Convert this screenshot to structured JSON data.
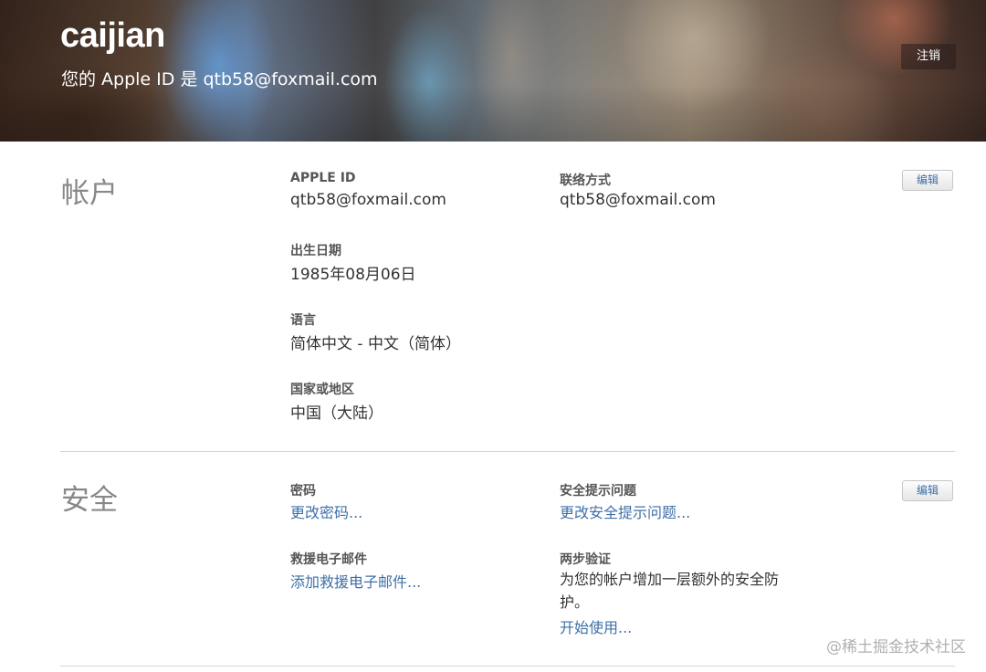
{
  "header": {
    "username": "caijian",
    "subtitle": "您的 Apple ID 是 qtb58@foxmail.com",
    "signout_label": "注销"
  },
  "account": {
    "title": "帐户",
    "edit_label": "编辑",
    "apple_id_label": "APPLE ID",
    "apple_id_value": "qtb58@foxmail.com",
    "contact_label": "联络方式",
    "contact_value": "qtb58@foxmail.com",
    "birthday_label": "出生日期",
    "birthday_value": "1985年08月06日",
    "language_label": "语言",
    "language_value": "简体中文 - 中文（简体）",
    "region_label": "国家或地区",
    "region_value": "中国（大陆）"
  },
  "security": {
    "title": "安全",
    "edit_label": "编辑",
    "password_label": "密码",
    "password_link": "更改密码...",
    "question_label": "安全提示问题",
    "question_link": "更改安全提示问题...",
    "rescue_label": "救援电子邮件",
    "rescue_link": "添加救援电子邮件...",
    "twostep_label": "两步验证",
    "twostep_desc": "为您的帐户增加一层额外的安全防护。",
    "twostep_link": "开始使用..."
  },
  "watermark": "@稀土掘金技术社区"
}
